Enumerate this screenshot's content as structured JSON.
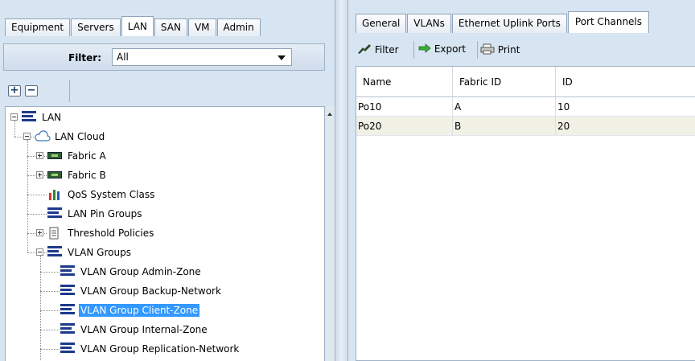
{
  "nav_tabs": [
    "Equipment",
    "Servers",
    "LAN",
    "SAN",
    "VM",
    "Admin"
  ],
  "active_nav_tab": "LAN",
  "filter": {
    "label": "Filter:",
    "value": "All"
  },
  "tree_toolbar": {
    "expand_symbol": "+",
    "collapse_symbol": "−"
  },
  "tree": [
    {
      "label": "LAN",
      "icon": "lan-icon",
      "expander": "minus"
    },
    {
      "label": "LAN Cloud",
      "icon": "cloud-icon",
      "expander": "minus"
    },
    {
      "label": "Fabric A",
      "icon": "fabric-icon",
      "expander": "plus"
    },
    {
      "label": "Fabric B",
      "icon": "fabric-icon",
      "expander": "plus"
    },
    {
      "label": "QoS System Class",
      "icon": "qos-icon",
      "expander": "none"
    },
    {
      "label": "LAN Pin Groups",
      "icon": "lan-icon",
      "expander": "none"
    },
    {
      "label": "Threshold Policies",
      "icon": "threshold-icon",
      "expander": "plus"
    },
    {
      "label": "VLAN Groups",
      "icon": "lan-icon",
      "expander": "minus"
    },
    {
      "label": "VLAN Group Admin-Zone",
      "icon": "lan-icon",
      "expander": "none"
    },
    {
      "label": "VLAN Group Backup-Network",
      "icon": "lan-icon",
      "expander": "none"
    },
    {
      "label": "VLAN Group Client-Zone",
      "icon": "lan-icon",
      "expander": "none",
      "selected": true
    },
    {
      "label": "VLAN Group Internal-Zone",
      "icon": "lan-icon",
      "expander": "none"
    },
    {
      "label": "VLAN Group Replication-Network",
      "icon": "lan-icon",
      "expander": "none"
    }
  ],
  "right_tabs": [
    "General",
    "VLANs",
    "Ethernet Uplink Ports",
    "Port Channels"
  ],
  "active_right_tab": "Port Channels",
  "right_toolbar": {
    "filter": "Filter",
    "export": "Export",
    "print": "Print"
  },
  "table": {
    "columns": [
      "Name",
      "Fabric ID",
      "ID"
    ],
    "rows": [
      [
        "Po10",
        "A",
        "10"
      ],
      [
        "Po20",
        "B",
        "20"
      ]
    ]
  },
  "colors": {
    "selection": "#3399ff",
    "lan_icon": "#1c3a8c",
    "alt_row": "#f1f1e6"
  }
}
